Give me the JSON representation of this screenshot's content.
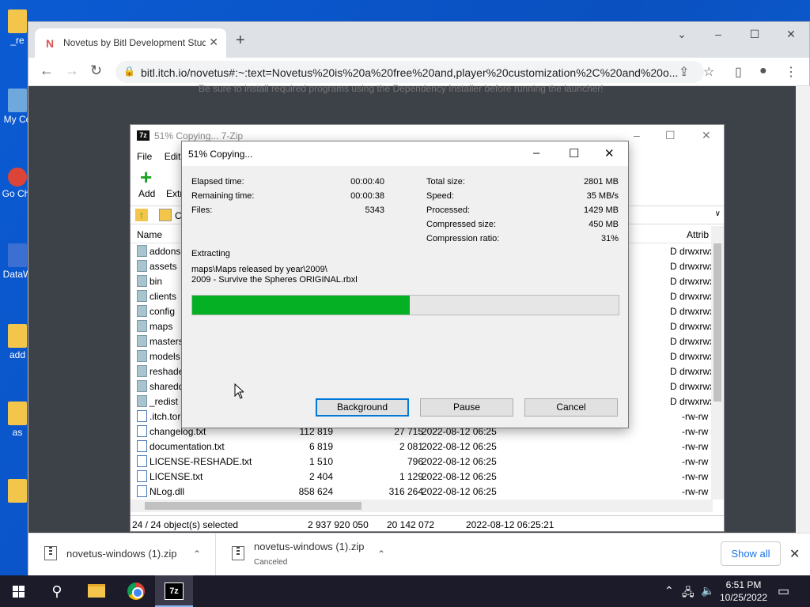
{
  "desktop": {
    "icons": [
      {
        "label": "_re"
      },
      {
        "label": "My Co"
      },
      {
        "label": "Go Chr"
      },
      {
        "label": "DataW"
      },
      {
        "label": "add"
      },
      {
        "label": "as"
      }
    ]
  },
  "chrome": {
    "tab_title": "Novetus by Bitl Development Studio",
    "tab_favicon": "N",
    "url": "bitl.itch.io/novetus#:~:text=Novetus%20is%20a%20free%20and,player%20customization%2C%20and%20o...",
    "page_note": "Be sure to install required programs using the Dependency Installer before running the launcher!",
    "downloads": [
      {
        "name": "novetus-windows (1).zip",
        "status": ""
      },
      {
        "name": "novetus-windows (1).zip",
        "status": "Canceled"
      }
    ],
    "show_all": "Show all"
  },
  "zip_window": {
    "title": "51% Copying... 7-Zip",
    "icon_text": "7z",
    "menu": [
      "File",
      "Edit"
    ],
    "toolbar": {
      "add": "Add",
      "extract": "Extr"
    },
    "path_text": "C",
    "columns": {
      "name": "Name",
      "attributes": "Attrib"
    },
    "rows": [
      {
        "type": "folder",
        "name": "addons",
        "size": "",
        "packed": "",
        "modified": "",
        "attr": "D drwxrwx"
      },
      {
        "type": "folder",
        "name": "assets",
        "size": "",
        "packed": "",
        "modified": "",
        "attr": "D drwxrwx"
      },
      {
        "type": "folder",
        "name": "bin",
        "size": "",
        "packed": "",
        "modified": "",
        "attr": "D drwxrwx"
      },
      {
        "type": "folder",
        "name": "clients",
        "size": "",
        "packed": "",
        "modified": "",
        "attr": "D drwxrwx"
      },
      {
        "type": "folder",
        "name": "config",
        "size": "",
        "packed": "",
        "modified": "",
        "attr": "D drwxrwx"
      },
      {
        "type": "folder",
        "name": "maps",
        "size": "",
        "packed": "",
        "modified": "",
        "attr": "D drwxrwx"
      },
      {
        "type": "folder",
        "name": "masters",
        "size": "",
        "packed": "",
        "modified": "",
        "attr": "D drwxrwx"
      },
      {
        "type": "folder",
        "name": "models",
        "size": "",
        "packed": "",
        "modified": "",
        "attr": "D drwxrwx"
      },
      {
        "type": "folder",
        "name": "reshade",
        "size": "",
        "packed": "",
        "modified": "",
        "attr": "D drwxrwx"
      },
      {
        "type": "folder",
        "name": "sharedd",
        "size": "",
        "packed": "",
        "modified": "",
        "attr": "D drwxrwx"
      },
      {
        "type": "folder",
        "name": "_redist",
        "size": "",
        "packed": "",
        "modified": "",
        "attr": "D drwxrwx"
      },
      {
        "type": "file",
        "name": ".itch.tor",
        "size": "",
        "packed": "",
        "modified": "",
        "attr": "-rw-rw"
      },
      {
        "type": "file",
        "name": "changelog.txt",
        "size": "112 819",
        "packed": "27 715",
        "modified": "2022-08-12 06:25",
        "attr": "-rw-rw"
      },
      {
        "type": "file",
        "name": "documentation.txt",
        "size": "6 819",
        "packed": "2 081",
        "modified": "2022-08-12 06:25",
        "attr": "-rw-rw"
      },
      {
        "type": "file",
        "name": "LICENSE-RESHADE.txt",
        "size": "1 510",
        "packed": "796",
        "modified": "2022-08-12 06:25",
        "attr": "-rw-rw"
      },
      {
        "type": "file",
        "name": "LICENSE.txt",
        "size": "2 404",
        "packed": "1 129",
        "modified": "2022-08-12 06:25",
        "attr": "-rw-rw"
      },
      {
        "type": "file",
        "name": "NLog.dll",
        "size": "858 624",
        "packed": "316 264",
        "modified": "2022-08-12 06:25",
        "attr": "-rw-rw"
      }
    ],
    "status": {
      "selected": "24 / 24 object(s) selected",
      "size": "2 937 920 050",
      "packed": "20 142 072",
      "modified": "2022-08-12 06:25:21"
    }
  },
  "dialog": {
    "title": "51% Copying...",
    "left": [
      {
        "label": "Elapsed time:",
        "value": "00:00:40"
      },
      {
        "label": "Remaining time:",
        "value": "00:00:38"
      },
      {
        "label": "Files:",
        "value": "5343"
      }
    ],
    "right": [
      {
        "label": "Total size:",
        "value": "2801 MB"
      },
      {
        "label": "Speed:",
        "value": "35 MB/s"
      },
      {
        "label": "Processed:",
        "value": "1429 MB"
      },
      {
        "label": "Compressed size:",
        "value": "450 MB"
      },
      {
        "label": "Compression ratio:",
        "value": "31%"
      }
    ],
    "operation": "Extracting",
    "path_line1": "maps\\Maps released by year\\2009\\",
    "path_line2": "2009 - Survive the Spheres ORIGINAL.rbxl",
    "progress": 0.51,
    "buttons": {
      "background": "Background",
      "pause": "Pause",
      "cancel": "Cancel"
    }
  },
  "taskbar": {
    "time": "6:51 PM",
    "date": "10/25/2022",
    "zip_label": "7z"
  },
  "colors": {
    "progress_fill": "#06b025",
    "accent": "#0078d7"
  }
}
